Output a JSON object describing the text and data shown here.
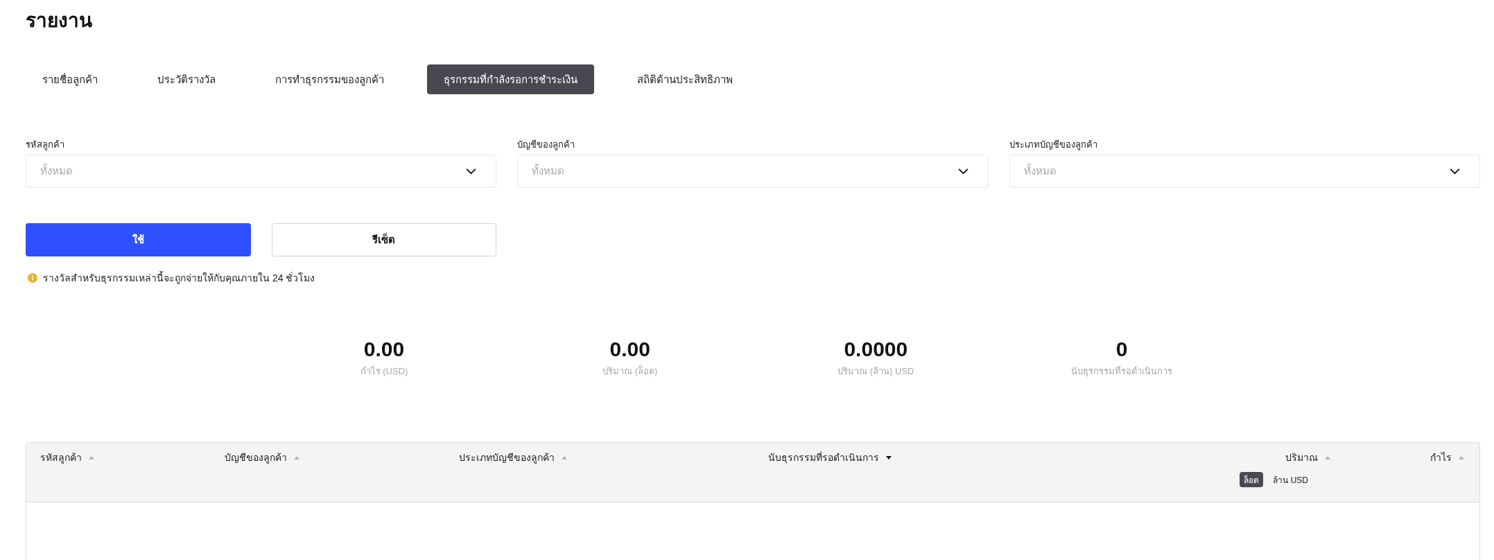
{
  "page": {
    "title": "รายงาน"
  },
  "tabs": [
    {
      "label": "รายชื่อลูกค้า",
      "selected": false
    },
    {
      "label": "ประวัติรางวัล",
      "selected": false
    },
    {
      "label": "การทำธุรกรรมของลูกค้า",
      "selected": false
    },
    {
      "label": "ธุรกรรมที่กำลังรอการชำระเงิน",
      "selected": true
    },
    {
      "label": "สถิติด้านประสิทธิภาพ",
      "selected": false
    }
  ],
  "filters": [
    {
      "label": "รหัสลูกค้า",
      "placeholder": "ทั้งหมด"
    },
    {
      "label": "บัญชีของลูกค้า",
      "placeholder": "ทั้งหมด"
    },
    {
      "label": "ประเภทบัญชีของลูกค้า",
      "placeholder": "ทั้งหมด"
    }
  ],
  "buttons": [
    {
      "label": "ใช้",
      "kind": "primary"
    },
    {
      "label": "รีเซ็ต",
      "kind": "secondary"
    }
  ],
  "notice": {
    "text": "รางวัลสำหรับธุรกรรมเหล่านี้จะถูกจ่ายให้กับคุณภายใน 24 ชั่วโมง"
  },
  "stats": [
    {
      "value": "0.00",
      "label": "กำไร (USD)"
    },
    {
      "value": "0.00",
      "label": "ปริมาณ (ล็อต)"
    },
    {
      "value": "0.0000",
      "label": "ปริมาณ (ล้าน) USD"
    },
    {
      "value": "0",
      "label": "นับธุรกรรมที่รอดำเนินการ"
    }
  ],
  "table": {
    "columns": [
      {
        "label": "รหัสลูกค้า",
        "sorted": false
      },
      {
        "label": "บัญชีของลูกค้า",
        "sorted": false
      },
      {
        "label": "ประเภทบัญชีของลูกค้า",
        "sorted": false
      },
      {
        "label": "นับธุรกรรมที่รอดำเนินการ",
        "sorted": true
      },
      {
        "label": "ปริมาณ",
        "sorted": false,
        "units": [
          {
            "label": "ล็อต",
            "selected": true
          },
          {
            "label": "ล้าน USD",
            "selected": false
          }
        ]
      },
      {
        "label": "กำไร",
        "sorted": false
      }
    ]
  }
}
